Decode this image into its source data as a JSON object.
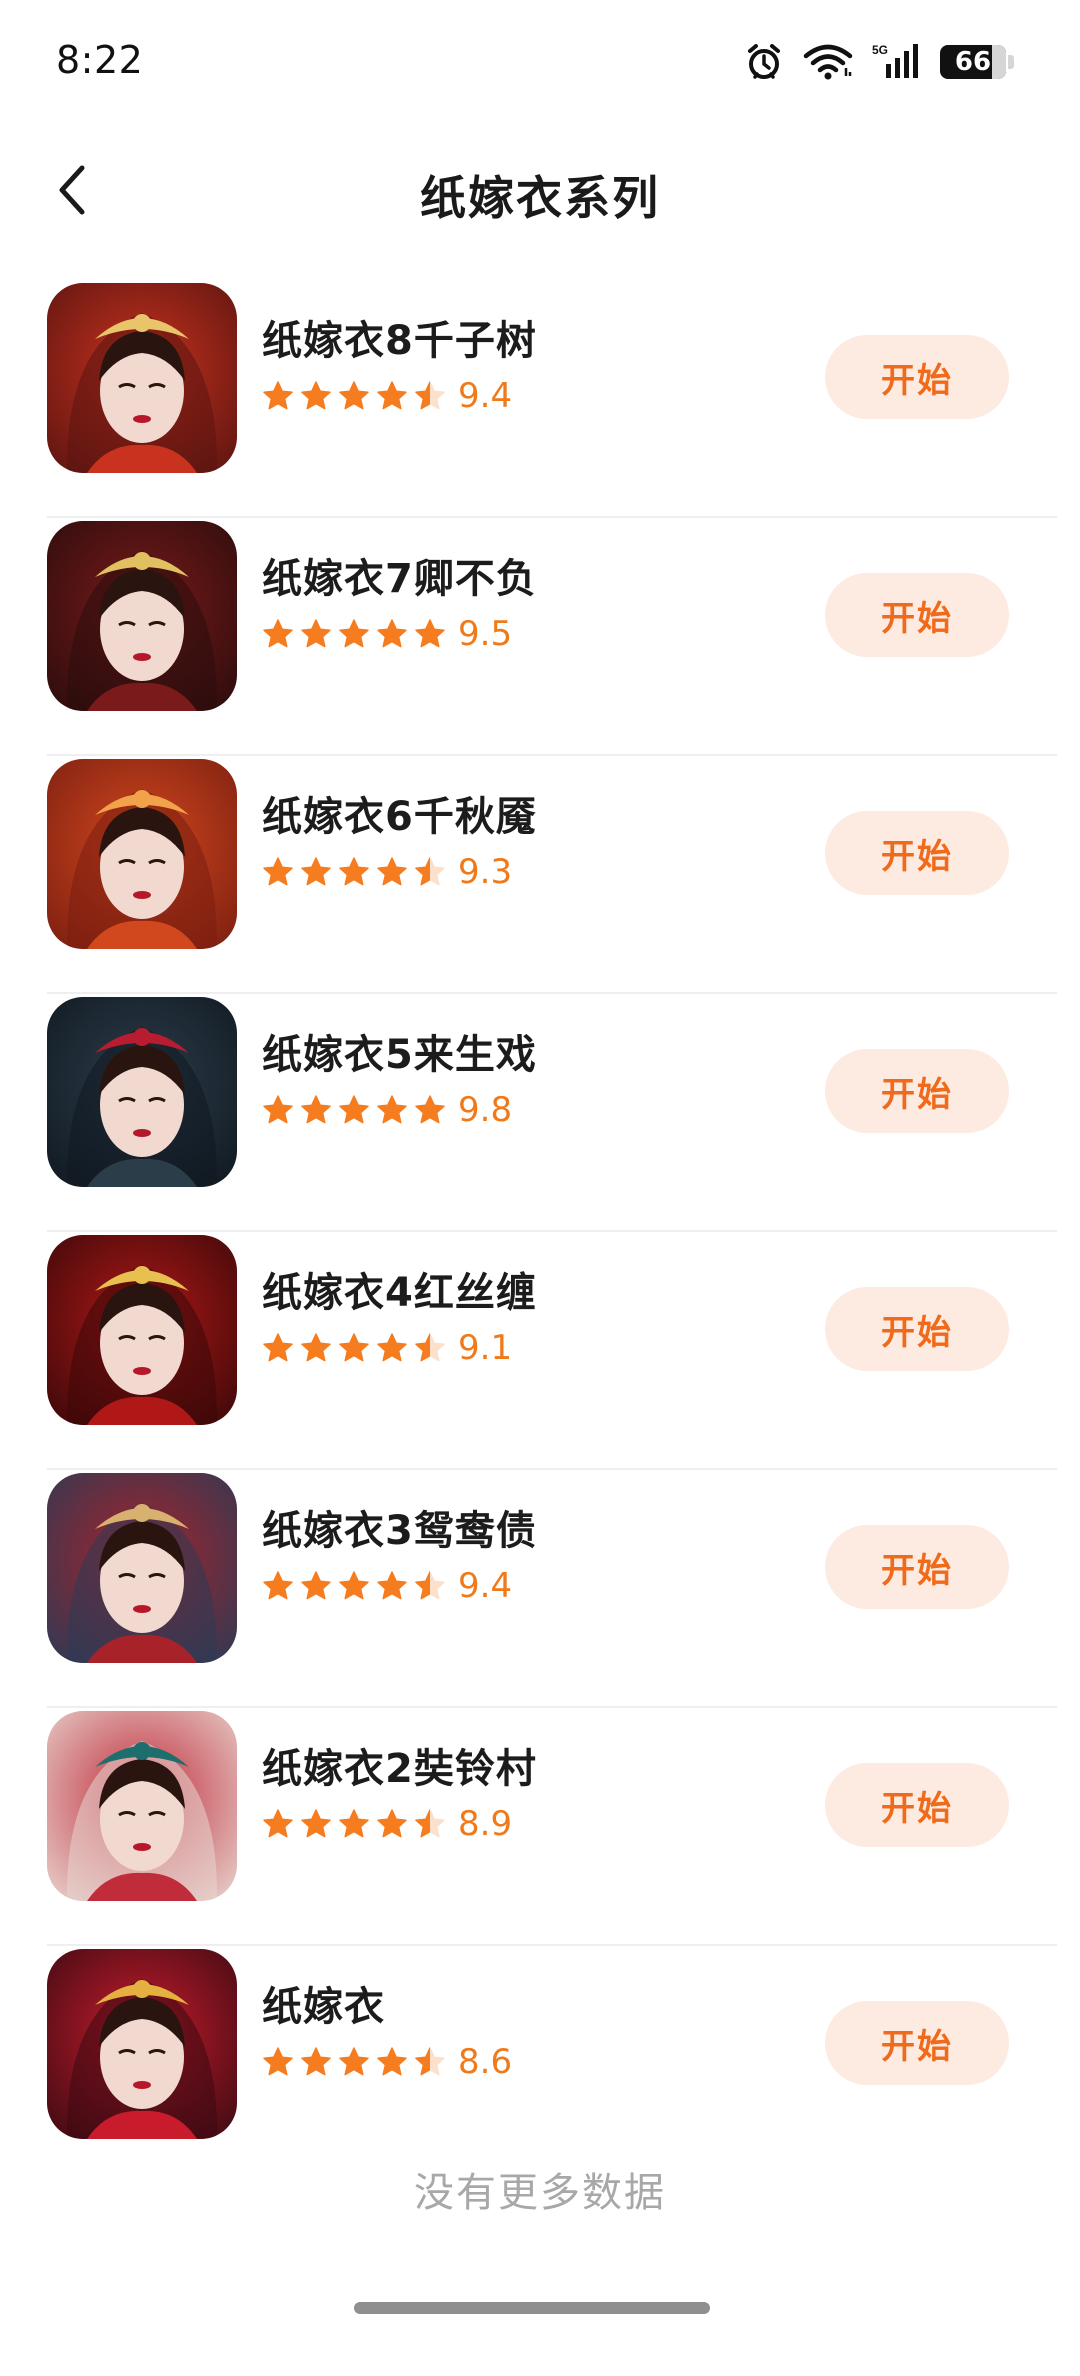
{
  "status_bar": {
    "time": "8:22",
    "network": "5G",
    "battery": "66"
  },
  "header": {
    "title": "纸嫁衣系列",
    "back_icon": "chevron-left-icon"
  },
  "games": [
    {
      "name": "纸嫁衣8千子树",
      "rating": "9.4",
      "stars": 4.5,
      "button": "开始",
      "art": {
        "bg1": "#c8321e",
        "bg2": "#5a1410",
        "accent": "#e9c46a"
      }
    },
    {
      "name": "纸嫁衣7卿不负",
      "rating": "9.5",
      "stars": 5,
      "button": "开始",
      "art": {
        "bg1": "#7a1a1a",
        "bg2": "#2a0c0c",
        "accent": "#e0c060"
      }
    },
    {
      "name": "纸嫁衣6千秋魇",
      "rating": "9.3",
      "stars": 4.5,
      "button": "开始",
      "art": {
        "bg1": "#d2481e",
        "bg2": "#7a1e10",
        "accent": "#f2a24a"
      }
    },
    {
      "name": "纸嫁衣5来生戏",
      "rating": "9.8",
      "stars": 5,
      "button": "开始",
      "art": {
        "bg1": "#2c3d4a",
        "bg2": "#101820",
        "accent": "#b81c30"
      }
    },
    {
      "name": "纸嫁衣4红丝缠",
      "rating": "9.1",
      "stars": 4.5,
      "button": "开始",
      "art": {
        "bg1": "#b01818",
        "bg2": "#3a0808",
        "accent": "#e8c050"
      }
    },
    {
      "name": "纸嫁衣3鸳鸯债",
      "rating": "9.4",
      "stars": 4.5,
      "button": "开始",
      "art": {
        "bg1": "#a8222a",
        "bg2": "#2c3a55",
        "accent": "#d8b070"
      }
    },
    {
      "name": "纸嫁衣2奘铃村",
      "rating": "8.9",
      "stars": 4.5,
      "button": "开始",
      "art": {
        "bg1": "#c02c3a",
        "bg2": "#e8d6d0",
        "accent": "#1f6e6e"
      }
    },
    {
      "name": "纸嫁衣",
      "rating": "8.6",
      "stars": 4.5,
      "button": "开始",
      "art": {
        "bg1": "#c81c2c",
        "bg2": "#3a0a12",
        "accent": "#e6b040"
      }
    }
  ],
  "footer": {
    "no_more_text": "没有更多数据"
  },
  "colors": {
    "accent": "#f06a1b",
    "star": "#f57c1f",
    "star_empty": "#fbe0cc",
    "button_bg": "#fdebe2"
  }
}
